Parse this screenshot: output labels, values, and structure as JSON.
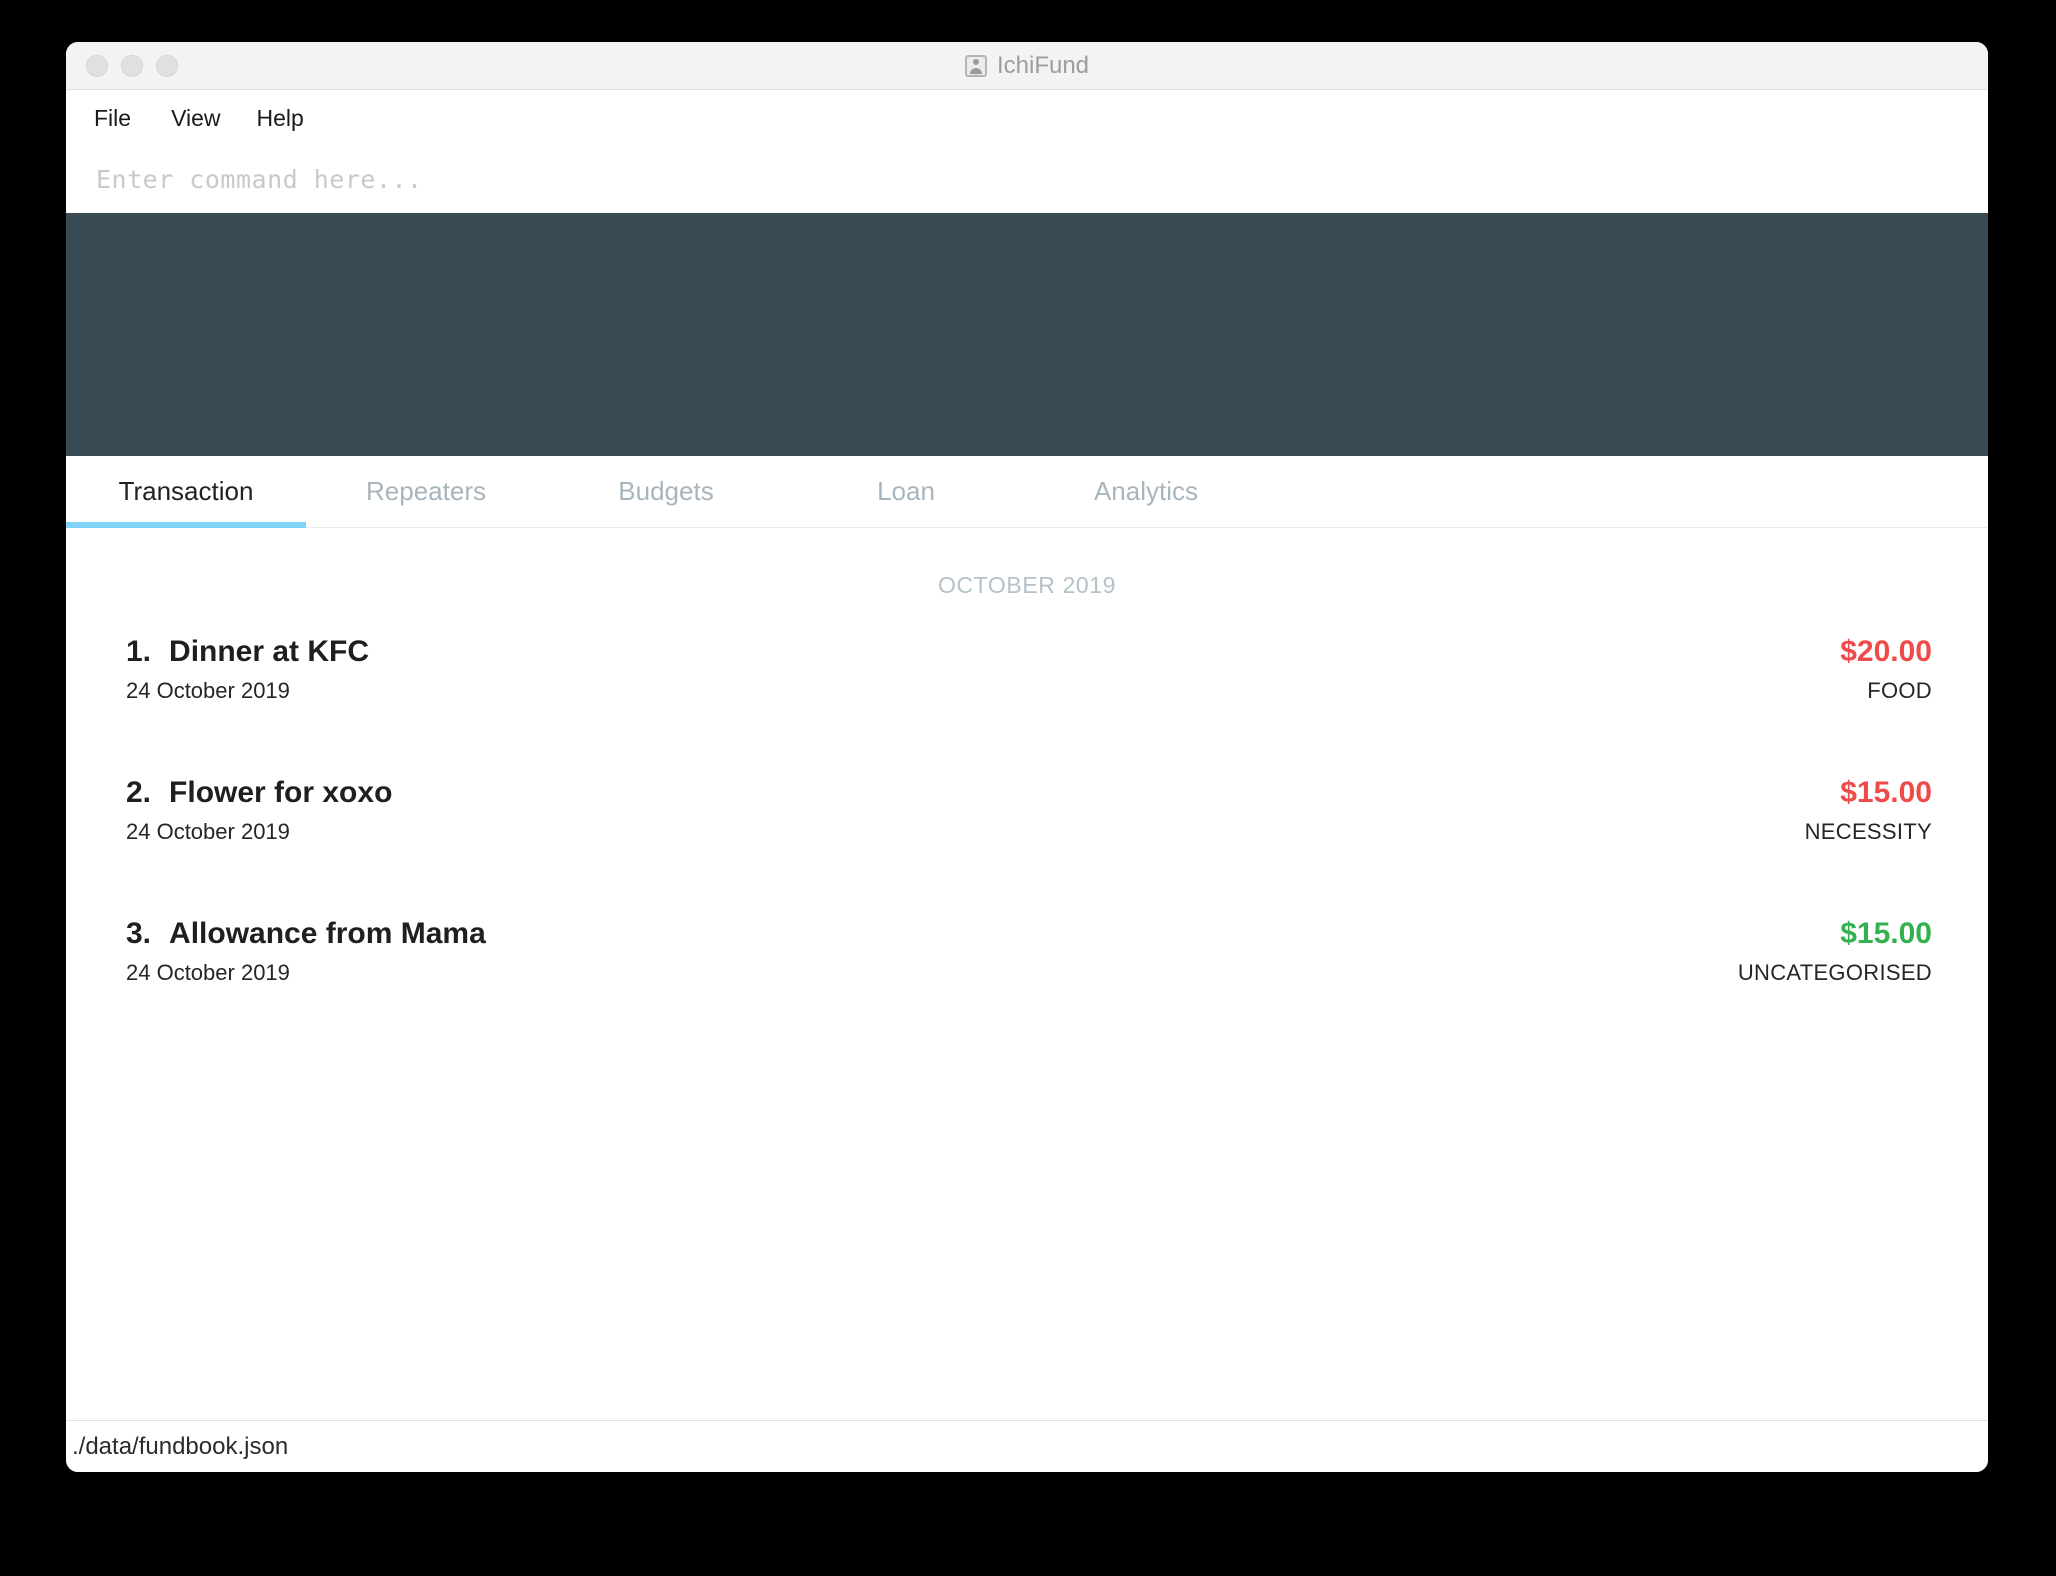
{
  "window": {
    "title": "IchiFund",
    "title_icon": "contact-card-icon",
    "traffic_lights": [
      "close",
      "minimize",
      "maximize"
    ]
  },
  "menubar": {
    "items": [
      {
        "label": "File"
      },
      {
        "label": "View"
      },
      {
        "label": "Help"
      }
    ]
  },
  "command": {
    "value": "",
    "placeholder": "Enter command here..."
  },
  "tabs": [
    {
      "label": "Transaction",
      "active": true
    },
    {
      "label": "Repeaters",
      "active": false
    },
    {
      "label": "Budgets",
      "active": false
    },
    {
      "label": "Loan",
      "active": false
    },
    {
      "label": "Analytics",
      "active": false
    }
  ],
  "content": {
    "month_header": "OCTOBER 2019",
    "transactions": [
      {
        "index": "1.",
        "title": "Dinner at KFC",
        "date": "24 October 2019",
        "amount": "$20.00",
        "category": "FOOD",
        "type": "expense"
      },
      {
        "index": "2.",
        "title": "Flower for xoxo",
        "date": "24 October 2019",
        "amount": "$15.00",
        "category": "NECESSITY",
        "type": "expense"
      },
      {
        "index": "3.",
        "title": "Allowance from Mama",
        "date": "24 October 2019",
        "amount": "$15.00",
        "category": "UNCATEGORISED",
        "type": "income"
      }
    ]
  },
  "statusbar": {
    "file_path": "./data/fundbook.json"
  },
  "colors": {
    "dark_panel": "#384a53",
    "active_tab_underline": "#7fd4f7",
    "expense": "#ef4b4b",
    "income": "#34b14f",
    "month_header": "#b4c1c9",
    "inactive_tab": "#a8b5bd"
  }
}
